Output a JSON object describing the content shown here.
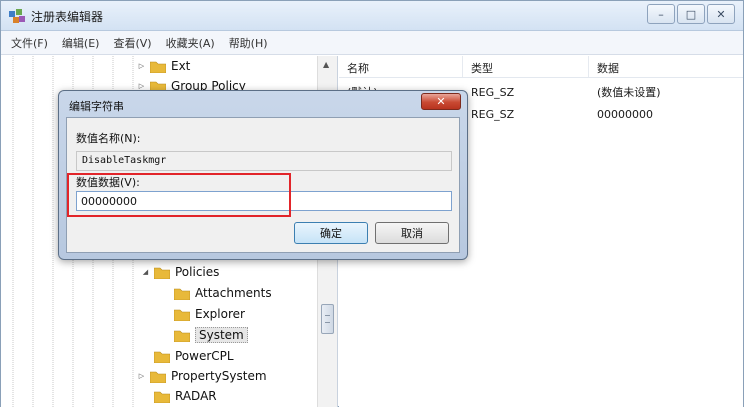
{
  "window": {
    "title": "注册表编辑器",
    "controls": {
      "minimize": "–",
      "maximize": "□",
      "close": "✕"
    }
  },
  "menu": [
    "文件(F)",
    "编辑(E)",
    "查看(V)",
    "收藏夹(A)",
    "帮助(H)"
  ],
  "tree": {
    "items": [
      {
        "label": "Ext",
        "expander": "▷"
      },
      {
        "label": "Group Policy",
        "expander": "▷"
      },
      {
        "label": "Policies",
        "expander": "◢"
      },
      {
        "label": "Attachments",
        "expander": ""
      },
      {
        "label": "Explorer",
        "expander": ""
      },
      {
        "label": "System",
        "expander": ""
      },
      {
        "label": "PowerCPL",
        "expander": ""
      },
      {
        "label": "PropertySystem",
        "expander": "▷"
      },
      {
        "label": "RADAR",
        "expander": ""
      }
    ]
  },
  "list": {
    "headers": [
      "名称",
      "类型",
      "数据"
    ],
    "rows": [
      {
        "name": "(默认)",
        "type": "REG_SZ",
        "data": "(数值未设置)"
      },
      {
        "name": "",
        "type": "REG_SZ",
        "data": "00000000"
      }
    ]
  },
  "dialog": {
    "title": "编辑字符串",
    "close_label": "✕",
    "name_label": "数值名称(N):",
    "name_value": "DisableTaskmgr",
    "data_label": "数值数据(V):",
    "data_value": "00000000",
    "ok_label": "确定",
    "cancel_label": "取消"
  },
  "colors": {
    "highlight": "#e2252a",
    "folder": "#e8b93a"
  }
}
